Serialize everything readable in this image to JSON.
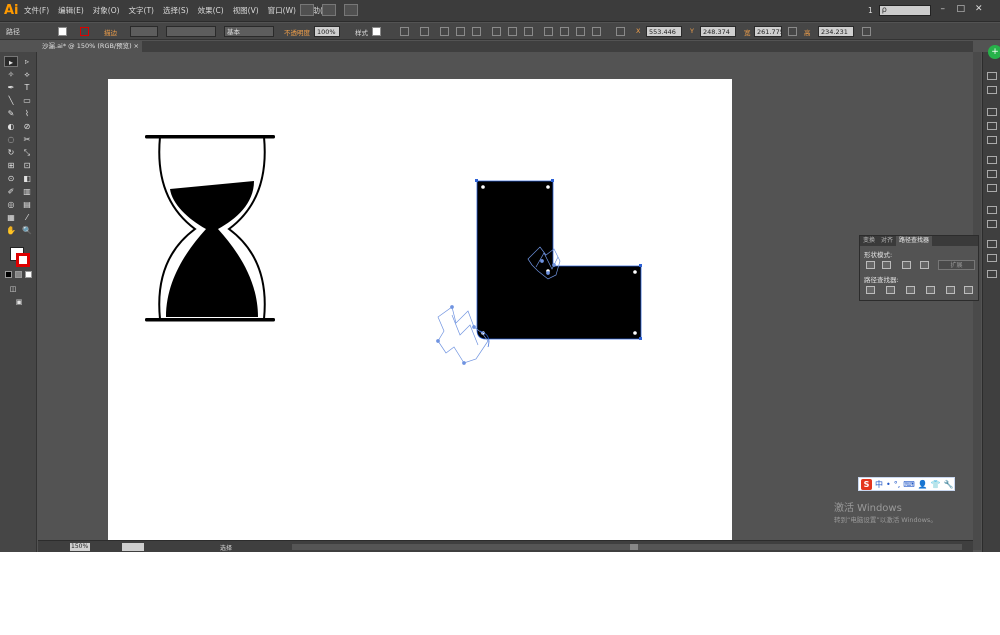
{
  "app": {
    "logo": "Ai"
  },
  "menu": [
    "文件(F)",
    "编辑(E)",
    "对象(O)",
    "文字(T)",
    "选择(S)",
    "效果(C)",
    "视图(V)",
    "窗口(W)",
    "帮助(H)"
  ],
  "workspace": {
    "number": "1",
    "search_glyph": "ρ"
  },
  "window_controls": {
    "minimize": "–",
    "restore": "□",
    "close": "✕"
  },
  "control_bar": {
    "selection_label": "路径",
    "stroke_label": "描边",
    "stroke_profile": "基本",
    "opacity_label": "不透明度",
    "opacity_value": "100%",
    "style_label": "样式",
    "x_label": "X",
    "x_value": "553.446",
    "y_label": "Y",
    "y_value": "248.374",
    "w_label": "宽",
    "w_value": "261.775",
    "h_label": "高",
    "h_value": "234.231"
  },
  "document": {
    "tab_title": "沙漏.ai* @ 150% (RGB/预览)",
    "close_glyph": "×"
  },
  "tools": [
    "▸",
    "▹",
    "✧",
    "⟡",
    "✒",
    "T",
    "╲",
    "▭",
    "✎",
    "⌇",
    "◐",
    "⊘",
    "◌",
    "✂",
    "↻",
    "⤡",
    "⊞",
    "⊡",
    "⊙",
    "◧",
    "✐",
    "▥",
    "◎",
    "▤",
    "▦",
    "⁄",
    "✋",
    "🔍"
  ],
  "statusbar": {
    "zoom": "150%",
    "status": "选择"
  },
  "pathfinder": {
    "tabs": [
      "变换",
      "对齐",
      "路径查找器"
    ],
    "active_tab": "路径查找器",
    "shape_modes_label": "形状模式:",
    "pathfinder_label": "路径查找器:",
    "expand_label": "扩展"
  },
  "ime": {
    "logo": "S",
    "items": [
      "中",
      "•",
      "°,",
      "⌨",
      "👤",
      "👕",
      "🔧"
    ]
  },
  "watermark": {
    "title": "激活 Windows",
    "subtitle": "转到“电脑设置”以激活 Windows。"
  },
  "dock_badge": "+",
  "colors": {
    "accent": "#f2a04a",
    "selection": "#2c61d6",
    "canvas": "#ffffff",
    "ui": "#535353"
  }
}
